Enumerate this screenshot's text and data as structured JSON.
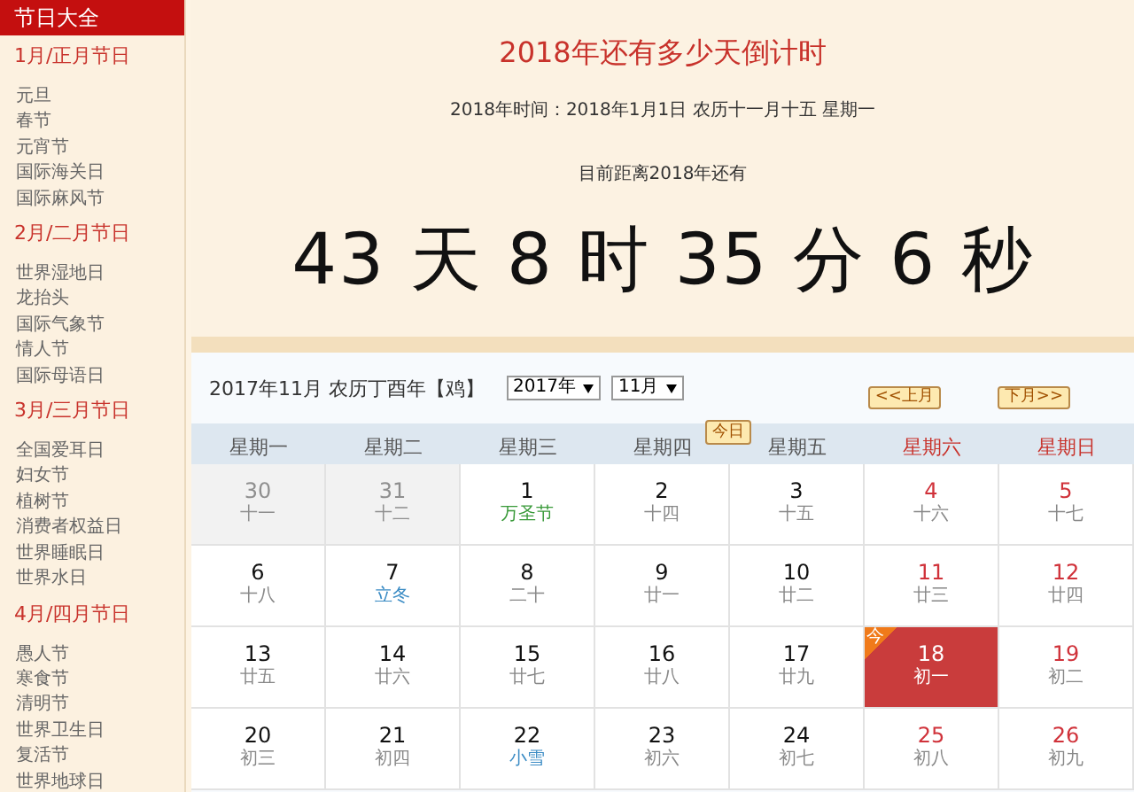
{
  "sidebar": {
    "title": "节日大全",
    "groups": [
      {
        "heading": "1月/正月节日",
        "items": [
          "元旦",
          "春节",
          "元宵节",
          "国际海关日",
          "国际麻风节"
        ]
      },
      {
        "heading": "2月/二月节日",
        "items": [
          "世界湿地日",
          "龙抬头",
          "国际气象节",
          "情人节",
          "国际母语日"
        ]
      },
      {
        "heading": "3月/三月节日",
        "items": [
          "全国爱耳日",
          "妇女节",
          "植树节",
          "消费者权益日",
          "世界睡眠日",
          "世界水日"
        ]
      },
      {
        "heading": "4月/四月节日",
        "items": [
          "愚人节",
          "寒食节",
          "清明节",
          "世界卫生日",
          "复活节",
          "世界地球日"
        ]
      }
    ]
  },
  "countdown": {
    "title": "2018年还有多少天倒计时",
    "date_line": "2018年时间：2018年1月1日 农历十一月十五 星期一",
    "lead": "目前距离2018年还有",
    "remaining": "43 天 8 时 35 分 6 秒"
  },
  "calendar": {
    "heading": "2017年11月 农历丁酉年【鸡】",
    "year_select": "2017年",
    "month_select": "11月",
    "prev_button": "<<上月",
    "next_button": "下月>>",
    "today_button": "今日",
    "weekdays": [
      {
        "label": "星期一",
        "weekend": false
      },
      {
        "label": "星期二",
        "weekend": false
      },
      {
        "label": "星期三",
        "weekend": false
      },
      {
        "label": "星期四",
        "weekend": false
      },
      {
        "label": "星期五",
        "weekend": false
      },
      {
        "label": "星期六",
        "weekend": true
      },
      {
        "label": "星期日",
        "weekend": true
      }
    ],
    "weeks": [
      [
        {
          "day": "30",
          "lunar": {
            "text": "十一",
            "kind": "normal"
          },
          "kind": "other",
          "selected": false
        },
        {
          "day": "31",
          "lunar": {
            "text": "十二",
            "kind": "normal"
          },
          "kind": "other",
          "selected": false
        },
        {
          "day": "1",
          "lunar": {
            "text": "万圣节",
            "kind": "festival"
          },
          "kind": "weekday",
          "selected": false
        },
        {
          "day": "2",
          "lunar": {
            "text": "十四",
            "kind": "normal"
          },
          "kind": "weekday",
          "selected": false
        },
        {
          "day": "3",
          "lunar": {
            "text": "十五",
            "kind": "normal"
          },
          "kind": "weekday",
          "selected": false
        },
        {
          "day": "4",
          "lunar": {
            "text": "十六",
            "kind": "normal"
          },
          "kind": "weekend",
          "selected": false
        },
        {
          "day": "5",
          "lunar": {
            "text": "十七",
            "kind": "normal"
          },
          "kind": "weekend",
          "selected": false
        }
      ],
      [
        {
          "day": "6",
          "lunar": {
            "text": "十八",
            "kind": "normal"
          },
          "kind": "weekday",
          "selected": false
        },
        {
          "day": "7",
          "lunar": {
            "text": "立冬",
            "kind": "term"
          },
          "kind": "weekday",
          "selected": false
        },
        {
          "day": "8",
          "lunar": {
            "text": "二十",
            "kind": "normal"
          },
          "kind": "weekday",
          "selected": false
        },
        {
          "day": "9",
          "lunar": {
            "text": "廿一",
            "kind": "normal"
          },
          "kind": "weekday",
          "selected": false
        },
        {
          "day": "10",
          "lunar": {
            "text": "廿二",
            "kind": "normal"
          },
          "kind": "weekday",
          "selected": false
        },
        {
          "day": "11",
          "lunar": {
            "text": "廿三",
            "kind": "normal"
          },
          "kind": "weekend",
          "selected": false
        },
        {
          "day": "12",
          "lunar": {
            "text": "廿四",
            "kind": "normal"
          },
          "kind": "weekend",
          "selected": false
        }
      ],
      [
        {
          "day": "13",
          "lunar": {
            "text": "廿五",
            "kind": "normal"
          },
          "kind": "weekday",
          "selected": false
        },
        {
          "day": "14",
          "lunar": {
            "text": "廿六",
            "kind": "normal"
          },
          "kind": "weekday",
          "selected": false
        },
        {
          "day": "15",
          "lunar": {
            "text": "廿七",
            "kind": "normal"
          },
          "kind": "weekday",
          "selected": false
        },
        {
          "day": "16",
          "lunar": {
            "text": "廿八",
            "kind": "normal"
          },
          "kind": "weekday",
          "selected": false
        },
        {
          "day": "17",
          "lunar": {
            "text": "廿九",
            "kind": "normal"
          },
          "kind": "weekday",
          "selected": false
        },
        {
          "day": "18",
          "lunar": {
            "text": "初一",
            "kind": "normal"
          },
          "kind": "weekend",
          "selected": true,
          "badge": "今"
        },
        {
          "day": "19",
          "lunar": {
            "text": "初二",
            "kind": "normal"
          },
          "kind": "weekend",
          "selected": false
        }
      ],
      [
        {
          "day": "20",
          "lunar": {
            "text": "初三",
            "kind": "normal"
          },
          "kind": "weekday",
          "selected": false
        },
        {
          "day": "21",
          "lunar": {
            "text": "初四",
            "kind": "normal"
          },
          "kind": "weekday",
          "selected": false
        },
        {
          "day": "22",
          "lunar": {
            "text": "小雪",
            "kind": "term"
          },
          "kind": "weekday",
          "selected": false
        },
        {
          "day": "23",
          "lunar": {
            "text": "初六",
            "kind": "normal"
          },
          "kind": "weekday",
          "selected": false
        },
        {
          "day": "24",
          "lunar": {
            "text": "初七",
            "kind": "normal"
          },
          "kind": "weekday",
          "selected": false
        },
        {
          "day": "25",
          "lunar": {
            "text": "初八",
            "kind": "normal"
          },
          "kind": "weekend",
          "selected": false
        },
        {
          "day": "26",
          "lunar": {
            "text": "初九",
            "kind": "normal"
          },
          "kind": "weekend",
          "selected": false
        }
      ]
    ]
  }
}
